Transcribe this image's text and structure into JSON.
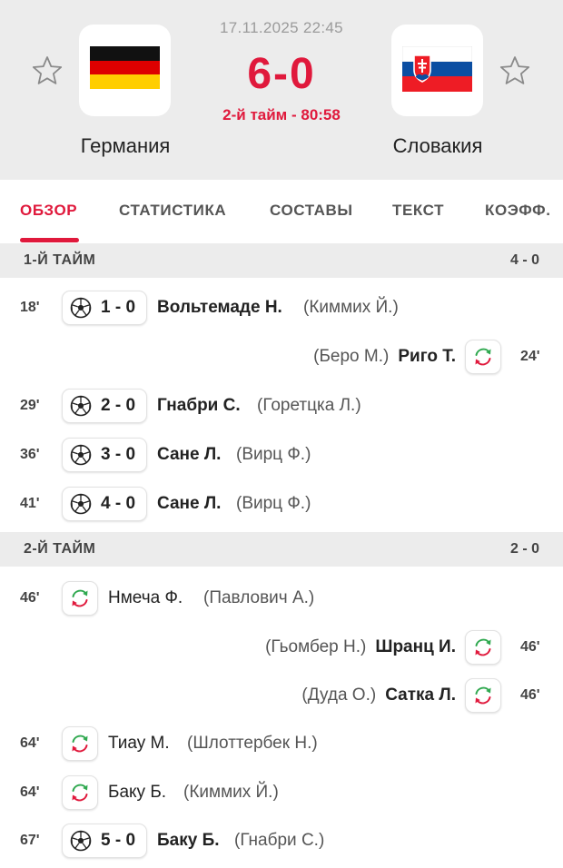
{
  "match": {
    "datetime": "17.11.2025 22:45",
    "score": "6-0",
    "status": "2-й тайм - 80:58",
    "home_team": "Германия",
    "away_team": "Словакия"
  },
  "colors": {
    "accent": "#e0193c",
    "sub_green": "#2fa84f",
    "sub_red": "#e0193c"
  },
  "tabs": [
    {
      "label": "ОБЗОР",
      "active": true
    },
    {
      "label": "СТАТИСТИКА",
      "active": false
    },
    {
      "label": "СОСТАВЫ",
      "active": false
    },
    {
      "label": "ТЕКСТ",
      "active": false
    },
    {
      "label": "КОЭФФ.",
      "active": false
    }
  ],
  "halves": [
    {
      "label": "1-Й ТАЙМ",
      "score": "4 - 0",
      "events": [
        {
          "minute": "18'",
          "side": "home",
          "type": "goal",
          "icon": "football-icon",
          "score": "1 - 0",
          "player": "Вольтемаде Н.",
          "assist": "(Киммих Й.)"
        },
        {
          "minute": "24'",
          "side": "away",
          "type": "substitution",
          "icon": "substitution-icon",
          "player": "Риго Т.",
          "assist": "(Беро М.)"
        },
        {
          "minute": "29'",
          "side": "home",
          "type": "goal",
          "icon": "football-icon",
          "score": "2 - 0",
          "player": "Гнабри С.",
          "assist": "(Горетцка Л.)"
        },
        {
          "minute": "36'",
          "side": "home",
          "type": "goal",
          "icon": "football-icon",
          "score": "3 - 0",
          "player": "Сане Л.",
          "assist": "(Вирц Ф.)"
        },
        {
          "minute": "41'",
          "side": "home",
          "type": "goal",
          "icon": "football-icon",
          "score": "4 - 0",
          "player": "Сане Л.",
          "assist": "(Вирц Ф.)"
        }
      ]
    },
    {
      "label": "2-Й ТАЙМ",
      "score": "2 - 0",
      "events": [
        {
          "minute": "46'",
          "side": "home",
          "type": "substitution",
          "icon": "substitution-icon",
          "player": "Нмеча Ф.",
          "assist": "(Павлович А.)"
        },
        {
          "minute": "46'",
          "side": "away",
          "type": "substitution",
          "icon": "substitution-icon",
          "player": "Шранц И.",
          "assist": "(Гьомбер Н.)"
        },
        {
          "minute": "46'",
          "side": "away",
          "type": "substitution",
          "icon": "substitution-icon",
          "player": "Сатка Л.",
          "assist": "(Дуда О.)"
        },
        {
          "minute": "64'",
          "side": "home",
          "type": "substitution",
          "icon": "substitution-icon",
          "player": "Тиау М.",
          "assist": "(Шлоттербек Н.)"
        },
        {
          "minute": "64'",
          "side": "home",
          "type": "substitution",
          "icon": "substitution-icon",
          "player": "Баку Б.",
          "assist": "(Киммих Й.)"
        },
        {
          "minute": "67'",
          "side": "home",
          "type": "goal",
          "icon": "football-icon",
          "score": "5 - 0",
          "player": "Баку Б.",
          "assist": "(Гнабри С.)"
        }
      ]
    }
  ]
}
